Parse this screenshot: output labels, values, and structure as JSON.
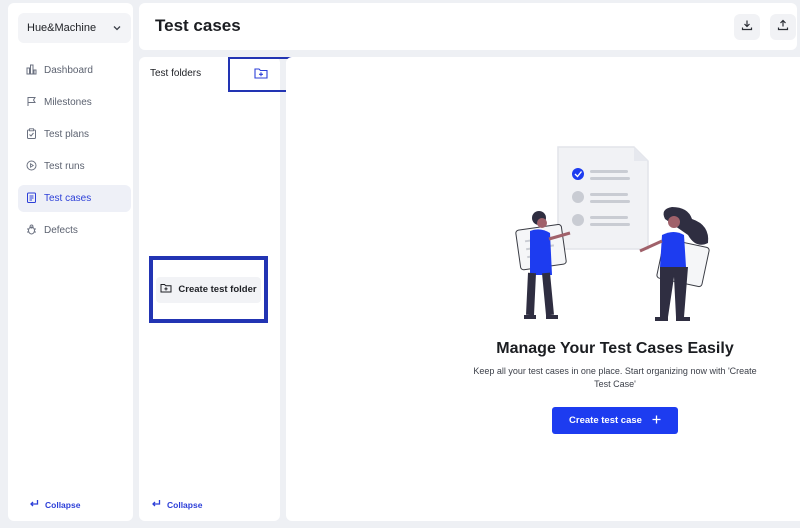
{
  "workspace": {
    "name": "Hue&Machine"
  },
  "sidebar": {
    "items": [
      {
        "label": "Dashboard",
        "icon": "dashboard-icon"
      },
      {
        "label": "Milestones",
        "icon": "flag-icon"
      },
      {
        "label": "Test plans",
        "icon": "clipboard-icon"
      },
      {
        "label": "Test runs",
        "icon": "play-circle-icon"
      },
      {
        "label": "Test cases",
        "icon": "test-case-icon",
        "active": true
      },
      {
        "label": "Defects",
        "icon": "bug-icon"
      }
    ],
    "collapse_label": "Collapse"
  },
  "header": {
    "title": "Test cases",
    "download_icon": "download-icon",
    "upload_icon": "upload-icon"
  },
  "folders_panel": {
    "title": "Test folders",
    "create_folder_label": "Create test folder",
    "collapse_label": "Collapse"
  },
  "empty_state": {
    "title": "Manage Your Test Cases Easily",
    "description": "Keep all your test cases in one place. Start organizing now with 'Create Test Case'",
    "create_button_label": "Create test case"
  },
  "colors": {
    "accent": "#1d3cf0",
    "highlight_border": "#2234b3",
    "background": "#eef0f4"
  }
}
